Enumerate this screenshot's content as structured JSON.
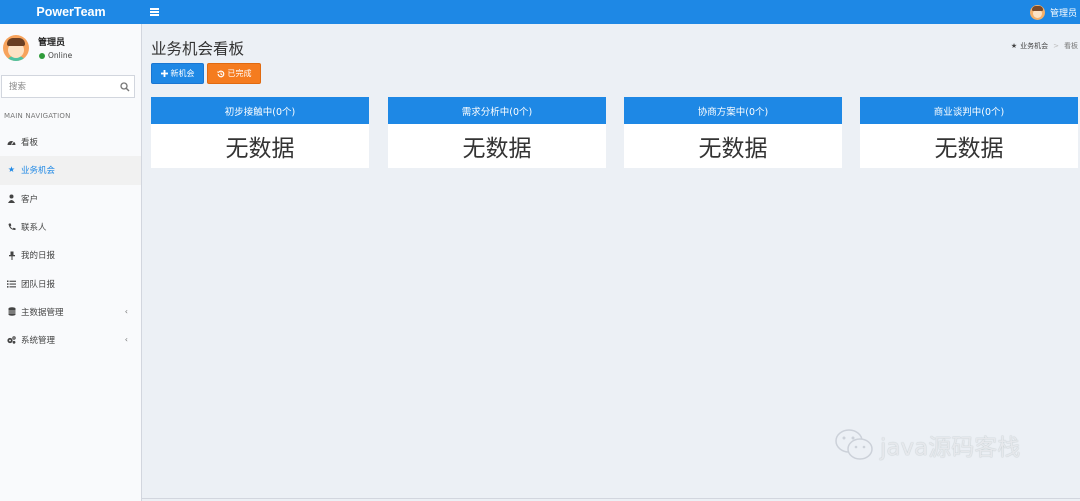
{
  "header": {
    "brand": "PowerTeam",
    "user_name": "管理员"
  },
  "sidebar": {
    "user": {
      "name": "管理员",
      "status": "Online"
    },
    "search": {
      "placeholder": "搜索"
    },
    "nav_header": "MAIN NAVIGATION",
    "items": [
      {
        "label": "看板",
        "icon": "dashboard-icon",
        "active": false
      },
      {
        "label": "业务机会",
        "icon": "star-icon",
        "active": true
      },
      {
        "label": "客户",
        "icon": "users-icon",
        "active": false
      },
      {
        "label": "联系人",
        "icon": "phone-icon",
        "active": false
      },
      {
        "label": "我的日报",
        "icon": "pin-icon",
        "active": false
      },
      {
        "label": "团队日报",
        "icon": "list-icon",
        "active": false
      },
      {
        "label": "主数据管理",
        "icon": "database-icon",
        "active": false,
        "expandable": true
      },
      {
        "label": "系统管理",
        "icon": "cogs-icon",
        "active": false,
        "expandable": true
      }
    ]
  },
  "main": {
    "title": "业务机会看板",
    "breadcrumb": {
      "parent": "业务机会",
      "current": "看板"
    },
    "buttons": {
      "new": "新机会",
      "done": "已完成"
    },
    "boards": [
      {
        "title": "初步接触中(0个)",
        "empty": "无数据"
      },
      {
        "title": "需求分析中(0个)",
        "empty": "无数据"
      },
      {
        "title": "协商方案中(0个)",
        "empty": "无数据"
      },
      {
        "title": "商业谈判中(0个)",
        "empty": "无数据"
      }
    ]
  },
  "watermark": {
    "text": "java源码客栈"
  },
  "colors": {
    "primary": "#1e88e5",
    "warning": "#f57c1f",
    "background": "#ecf0f5",
    "sidebar": "#f9fafc",
    "online": "#2e9b3a"
  }
}
